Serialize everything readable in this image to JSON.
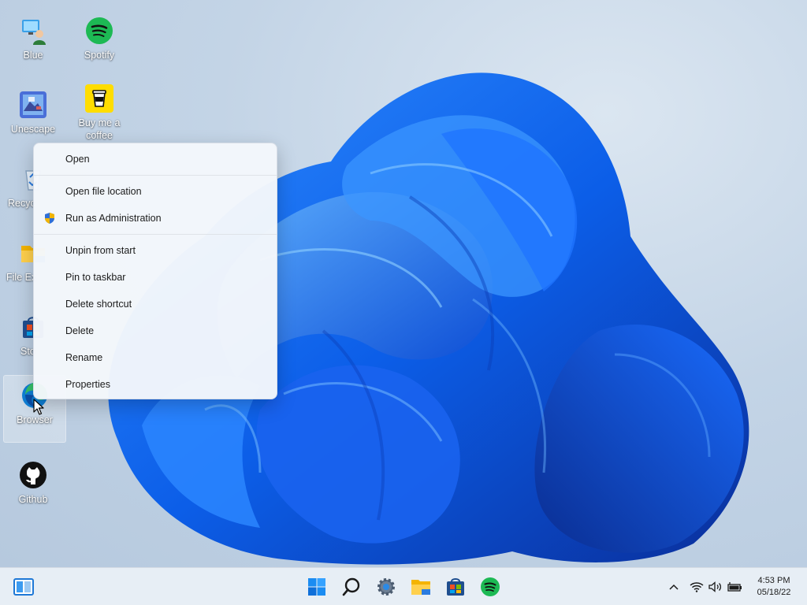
{
  "desktop": {
    "icons": [
      {
        "label": "Blue",
        "icon": "person-monitor-icon"
      },
      {
        "label": "Spotify",
        "icon": "spotify-icon"
      },
      {
        "label": "Unescape",
        "icon": "unescape-game-icon"
      },
      {
        "label": "Buy me a coffee",
        "icon": "coffee-cup-icon"
      },
      {
        "label": "Recycle Bin",
        "icon": "recycle-bin-icon"
      },
      {
        "label": "File Explorer",
        "icon": "folder-icon"
      },
      {
        "label": "Store",
        "icon": "store-icon"
      },
      {
        "label": "Browser",
        "icon": "edge-browser-icon"
      },
      {
        "label": "Github",
        "icon": "github-icon"
      }
    ],
    "visible_label_parts": {
      "recycle": "Recyc",
      "file_explorer": "File Ex",
      "store": "Sto"
    }
  },
  "context_menu": {
    "items": [
      {
        "label": "Open"
      },
      {
        "label": "Open file location"
      },
      {
        "label": "Run as Administration",
        "icon": "uac-shield-icon"
      },
      {
        "label": "Unpin from start"
      },
      {
        "label": "Pin to taskbar"
      },
      {
        "label": "Delete shortcut"
      },
      {
        "label": "Delete"
      },
      {
        "label": "Rename"
      },
      {
        "label": "Properties"
      }
    ]
  },
  "taskbar": {
    "left": {
      "icon": "widgets-icon"
    },
    "center": [
      {
        "icon": "windows-start-icon"
      },
      {
        "icon": "search-icon"
      },
      {
        "icon": "settings-gear-icon"
      },
      {
        "icon": "file-explorer-icon"
      },
      {
        "icon": "store-icon"
      },
      {
        "icon": "spotify-icon"
      }
    ],
    "tray": [
      {
        "icon": "chevron-up-icon"
      },
      {
        "icon": "wifi-icon"
      },
      {
        "icon": "volume-icon"
      },
      {
        "icon": "battery-icon"
      }
    ],
    "clock": {
      "time": "4:53 PM",
      "date": "05/18/22"
    }
  },
  "colors": {
    "accent": "#0a5ce6",
    "spotify": "#1db954",
    "taskbar": "#e8eef5"
  }
}
